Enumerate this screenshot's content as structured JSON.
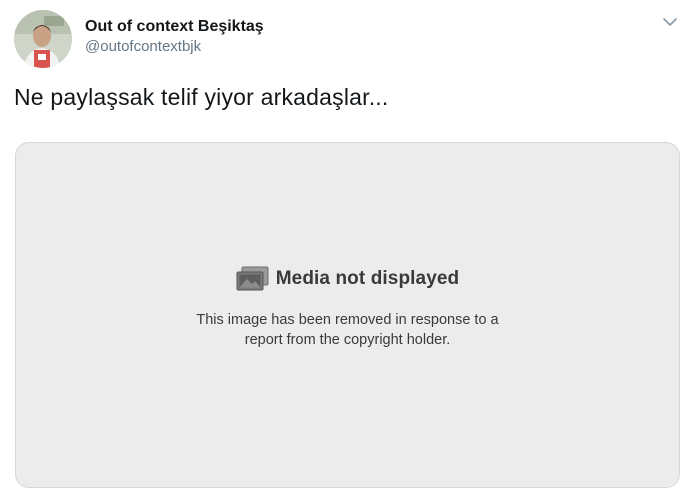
{
  "tweet": {
    "author": {
      "display_name": "Out of context Beşiktaş",
      "handle": "@outofcontextbjk"
    },
    "text": "Ne paylaşsak telif yiyor arkadaşlar...",
    "menu_icon": "chevron-down-icon"
  },
  "media_placeholder": {
    "icon": "media-placeholder-icon",
    "title": "Media not displayed",
    "description_line1": "This image has been removed in response to a",
    "description_line2": "report from the copyright holder."
  },
  "colors": {
    "text_primary": "#14171a",
    "text_secondary": "#657786",
    "media_background": "#ececec",
    "media_border": "#d4d8dc"
  }
}
